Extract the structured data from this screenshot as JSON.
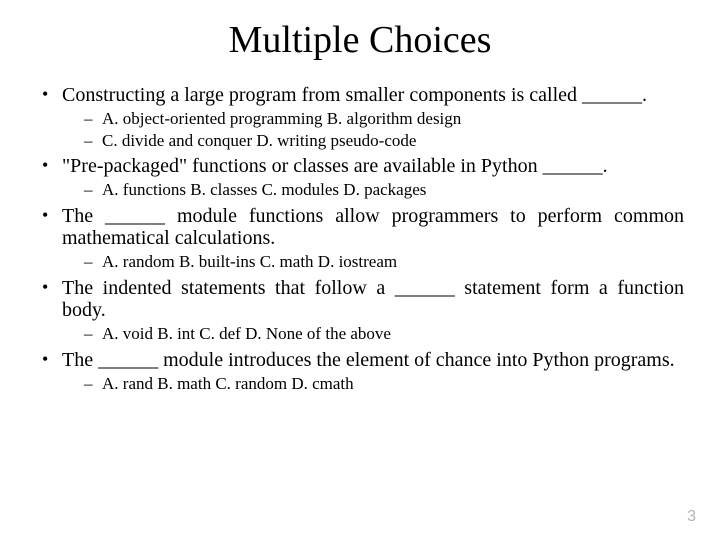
{
  "title": "Multiple Choices",
  "questions": [
    {
      "text": "Constructing a large program from smaller components is called ______.",
      "options": [
        "A. object-oriented programming   B. algorithm design",
        "C. divide and conquer   D. writing pseudo-code"
      ]
    },
    {
      "text": "\"Pre-packaged\" functions or classes are available in Python ______.",
      "options": [
        "A. functions   B. classes   C. modules  D. packages"
      ]
    },
    {
      "text": "The ______ module functions allow programmers to perform common mathematical calculations.",
      "options": [
        "A. random   B. built-ins   C. math    D. iostream"
      ]
    },
    {
      "text": "The indented statements that follow a ______ statement form a function body.",
      "options": [
        "A. void   B. int   C. def   D. None of the above"
      ]
    },
    {
      "text": "The ______ module introduces the element of chance into Python programs.",
      "options": [
        "A. rand    B. math    C. random   D. cmath"
      ]
    }
  ],
  "page_number": "3"
}
